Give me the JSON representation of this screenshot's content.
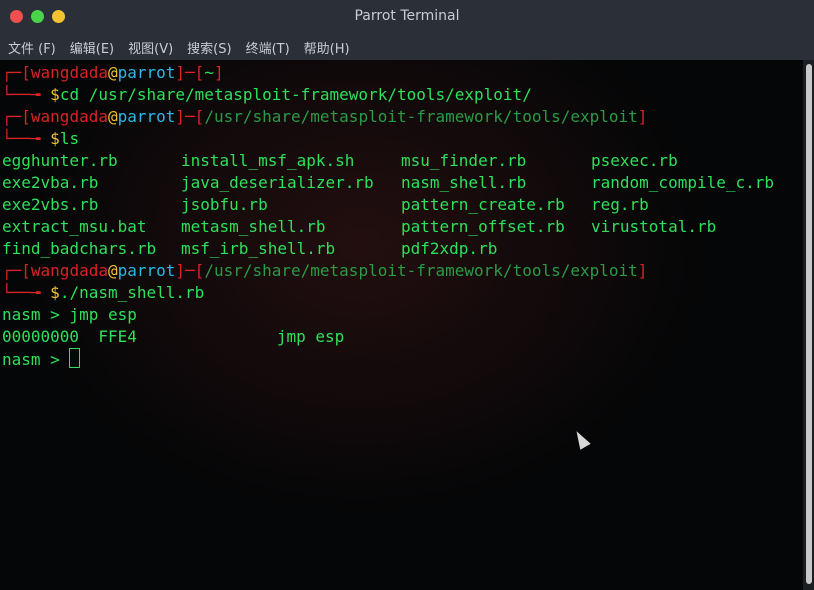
{
  "window": {
    "title": "Parrot Terminal"
  },
  "menu": [
    {
      "label": "文件 (F)"
    },
    {
      "label": "编辑(E)"
    },
    {
      "label": "视图(V)"
    },
    {
      "label": "搜索(S)"
    },
    {
      "label": "终端(T)"
    },
    {
      "label": "帮助(H)"
    }
  ],
  "terminal": {
    "p1": {
      "user": "wangdada",
      "host": "parrot",
      "dir": "~",
      "cmd": "cd /usr/share/metasploit-framework/tools/exploit/"
    },
    "p2": {
      "user": "wangdada",
      "host": "parrot",
      "dir": "/usr/share/metasploit-framework/tools/exploit",
      "cmd": "ls"
    },
    "ls": {
      "col1": [
        "egghunter.rb",
        "exe2vba.rb",
        "exe2vbs.rb",
        "extract_msu.bat",
        "find_badchars.rb"
      ],
      "col2": [
        "install_msf_apk.sh",
        "java_deserializer.rb",
        "jsobfu.rb",
        "metasm_shell.rb",
        "msf_irb_shell.rb"
      ],
      "col3": [
        "msu_finder.rb",
        "nasm_shell.rb",
        "pattern_create.rb",
        "pattern_offset.rb",
        "pdf2xdp.rb"
      ],
      "col4": [
        "psexec.rb",
        "random_compile_c.rb",
        "reg.rb",
        "virustotal.rb"
      ]
    },
    "p3": {
      "user": "wangdada",
      "host": "parrot",
      "dir": "/usr/share/metasploit-framework/tools/exploit",
      "cmd": "./nasm_shell.rb"
    },
    "nasm1": "nasm > jmp esp",
    "nasm_out": {
      "addr": "00000000",
      "hex": "FFE4",
      "asm": "jmp esp"
    },
    "nasm2": "nasm > "
  }
}
